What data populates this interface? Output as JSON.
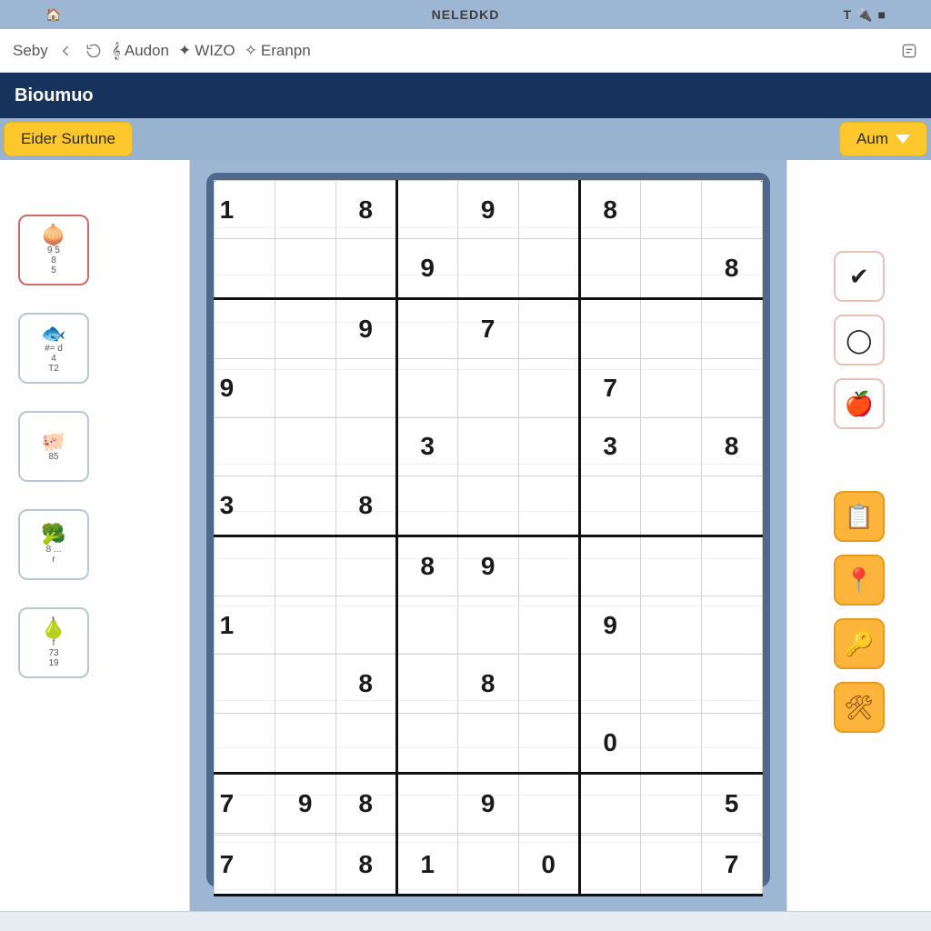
{
  "sysbar": {
    "title": "NELEDKD",
    "home_icon": "home-icon"
  },
  "toolbar": {
    "items": [
      {
        "label": "Seby"
      },
      {
        "label": "Audon"
      },
      {
        "label": "WIZO"
      },
      {
        "label": "Eranpn"
      }
    ]
  },
  "header": {
    "title": "Bioumuo"
  },
  "subband": {
    "left_button": "Eider Surtune",
    "right_button": "Aum"
  },
  "left_cards": [
    {
      "emoji": "🧅",
      "lines": [
        "9 5",
        "8",
        "5"
      ],
      "variant": "red"
    },
    {
      "emoji": "🐟",
      "lines": [
        "#= d",
        "4",
        "T2"
      ],
      "variant": ""
    },
    {
      "emoji": "🐖",
      "lines": [
        "",
        "85"
      ],
      "variant": ""
    },
    {
      "emoji": "🥦",
      "lines": [
        "8 ...",
        "r"
      ],
      "variant": ""
    },
    {
      "emoji": "🍐",
      "lines": [
        "f",
        "73",
        "19"
      ],
      "variant": ""
    }
  ],
  "right_icons_soft": [
    "✔",
    "◯",
    "🍎"
  ],
  "right_icons_orange": [
    "📋",
    "📍",
    "🔑",
    "🛠"
  ],
  "grid": [
    [
      "1",
      "",
      "8",
      "",
      "9",
      "",
      "8",
      "",
      ""
    ],
    [
      "",
      "",
      "",
      "9",
      "",
      "",
      "",
      "",
      "8"
    ],
    [
      "",
      "",
      "9",
      "",
      "7",
      "",
      "",
      "",
      ""
    ],
    [
      "9",
      "",
      "",
      "",
      "",
      "",
      "7",
      "",
      ""
    ],
    [
      "",
      "",
      "",
      "3",
      "",
      "",
      "3",
      "",
      "8"
    ],
    [
      "3",
      "",
      "8",
      "",
      "",
      "",
      "",
      "",
      ""
    ],
    [
      "",
      "",
      "",
      "8",
      "9",
      "",
      "",
      "",
      ""
    ],
    [
      "1",
      "",
      "",
      "",
      "",
      "",
      "9",
      "",
      ""
    ],
    [
      "",
      "",
      "8",
      "",
      "8",
      "",
      "",
      "",
      ""
    ],
    [
      "",
      "",
      "",
      "",
      "",
      "",
      "0",
      "",
      ""
    ],
    [
      "7",
      "9",
      "8",
      "",
      "9",
      "",
      "",
      "",
      "5"
    ],
    [
      "",
      "",
      "",
      "",
      "",
      "",
      "",
      "",
      ""
    ],
    [
      "7",
      "",
      "8",
      "1",
      "",
      "0",
      "",
      "",
      "7"
    ]
  ],
  "heavy_rows_after": [
    1,
    5,
    9,
    12
  ],
  "heavy_cols_after": [
    2,
    5
  ]
}
